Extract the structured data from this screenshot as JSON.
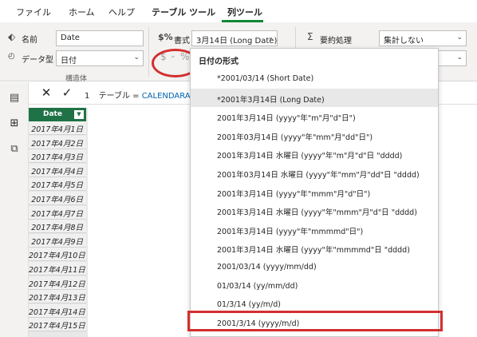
{
  "tabs": [
    {
      "label": "ファイル",
      "active": false
    },
    {
      "label": "ホーム",
      "active": false
    },
    {
      "label": "ヘルプ",
      "active": false
    },
    {
      "label": "テーブル ツール",
      "active": true
    },
    {
      "label": "列ツール",
      "active": true
    }
  ],
  "accent_color": "#118833",
  "ribbon": {
    "name_label": "名前",
    "name_value": "Date",
    "datatype_label": "データ型",
    "datatype_value": "日付",
    "structure_group_label": "構造体",
    "format_label": "書式",
    "format_value": "3月14日 (Long Date)",
    "currency_symbol": "$",
    "percent_symbol": "%",
    "summarize_label": "要約処理",
    "summarize_value": "集計しない"
  },
  "rail": {
    "icons": [
      "report-icon",
      "data-icon",
      "model-icon"
    ]
  },
  "formula_bar": {
    "cancel_glyph": "✕",
    "commit_glyph": "✓",
    "line_number": "1",
    "prefix": "テーブル = ",
    "function_text": "CALENDARAUTO"
  },
  "table": {
    "column_header": "Date",
    "rows": [
      "2017年4月1日",
      "2017年4月2日",
      "2017年4月3日",
      "2017年4月4日",
      "2017年4月5日",
      "2017年4月6日",
      "2017年4月7日",
      "2017年4月8日",
      "2017年4月9日",
      "2017年4月10日",
      "2017年4月11日",
      "2017年4月12日",
      "2017年4月13日",
      "2017年4月14日",
      "2017年4月15日"
    ]
  },
  "dropdown": {
    "header": "日付の形式",
    "options": [
      "*2001/03/14 (Short Date)",
      "*2001年3月14日 (Long Date)",
      "2001年3月14日 (yyyy\"年\"m\"月\"d\"日\")",
      "2001年03月14日 (yyyy\"年\"mm\"月\"dd\"日\")",
      "2001年3月14日 水曜日 (yyyy\"年\"m\"月\"d\"日 \"dddd)",
      "2001年03月14日 水曜日 (yyyy\"年\"mm\"月\"dd\"日 \"dddd)",
      "2001年3月14日 (yyyy\"年\"mmm\"月\"d\"日\")",
      "2001年3月14日 水曜日 (yyyy\"年\"mmm\"月\"d\"日 \"dddd)",
      "2001年3月14日 (yyyy\"年\"mmmmd\"日\")",
      "2001年3月14日 水曜日 (yyyy\"年\"mmmmd\"日 \"dddd)",
      "2001/03/14 (yyyy/mm/dd)",
      "01/03/14 (yy/mm/dd)",
      "01/3/14 (yy/m/d)",
      "2001/3/14 (yyyy/m/d)"
    ],
    "selected_index": 1,
    "highlighted_index": 13
  },
  "annotation_color": "#d32f2f"
}
